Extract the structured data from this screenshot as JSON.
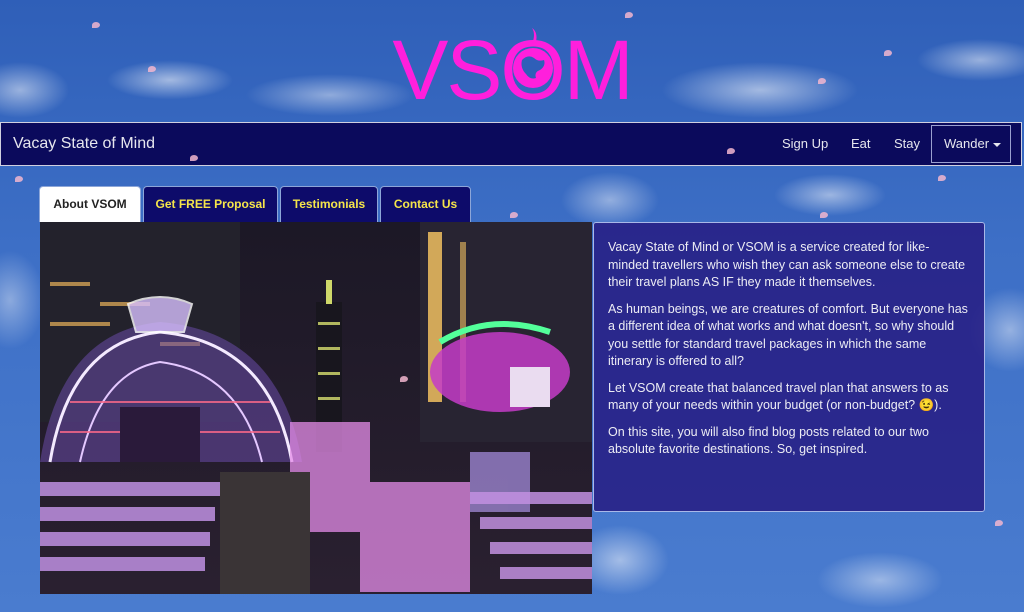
{
  "logo": {
    "text": "VSOM",
    "color": "#ff1fdc"
  },
  "navbar": {
    "brand": "Vacay State of Mind",
    "links": [
      "Sign Up",
      "Eat",
      "Stay"
    ],
    "dropdown": "Wander",
    "background": "#0b0a5c"
  },
  "tabs": [
    {
      "label": "About VSOM",
      "active": true
    },
    {
      "label": "Get FREE Proposal",
      "active": false
    },
    {
      "label": "Testimonials",
      "active": false
    },
    {
      "label": "Contact Us",
      "active": false
    }
  ],
  "about": {
    "paragraphs": [
      "Vacay State of Mind or VSOM is a service created for like-minded travellers who wish they can ask someone else to create their travel plans AS IF they made it themselves.",
      "As human beings, we are creatures of comfort. But everyone has a different idea of what works and what doesn't, so why should you settle for standard travel packages in which the same itinerary is offered to all?",
      "Let VSOM create that balanced travel plan that answers to as many of your needs within your budget (or non-budget? 😉).",
      "On this site, you will also find blog posts related to our two absolute favorite destinations. So, get inspired."
    ]
  },
  "photo": {
    "icon": "night-light-installation-photo"
  }
}
